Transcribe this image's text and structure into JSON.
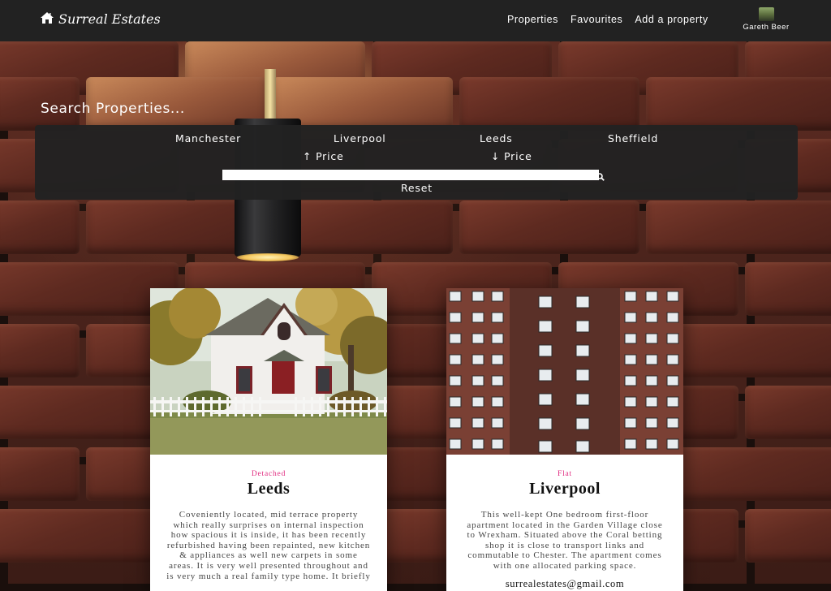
{
  "nav": {
    "brand": "Surreal Estates",
    "links": [
      "Properties",
      "Favourites",
      "Add a property"
    ],
    "user_name": "Gareth Beer"
  },
  "search": {
    "title": "Search Properties...",
    "cities": [
      "Manchester",
      "Liverpool",
      "Leeds",
      "Sheffield"
    ],
    "sort_asc": "Price",
    "sort_desc": "Price",
    "query": "",
    "reset": "Reset"
  },
  "properties": [
    {
      "type": "Detached",
      "city": "Leeds",
      "description": "Coveniently located, mid terrace property which really surprises on internal inspection how spacious it is inside, it has been recently refurbished having been repainted, new kitchen & appliances as well new carpets in some areas. It is very well presented throughout and is very much a real family type home. It briefly",
      "email": ""
    },
    {
      "type": "Flat",
      "city": "Liverpool",
      "description": "This well-kept One bedroom first-floor apartment located in the Garden Village close to Wrexham. Situated above the Coral betting shop it is close to transport links and commutable to Chester. The apartment comes with one allocated parking space.",
      "email": "surrealestates@gmail.com"
    }
  ],
  "colors": {
    "navbar": "#222222",
    "type_accent": "#e0287e",
    "panel": "#222222"
  },
  "icons": [
    "home-icon",
    "arrow-up-icon",
    "arrow-down-icon",
    "search-icon"
  ]
}
